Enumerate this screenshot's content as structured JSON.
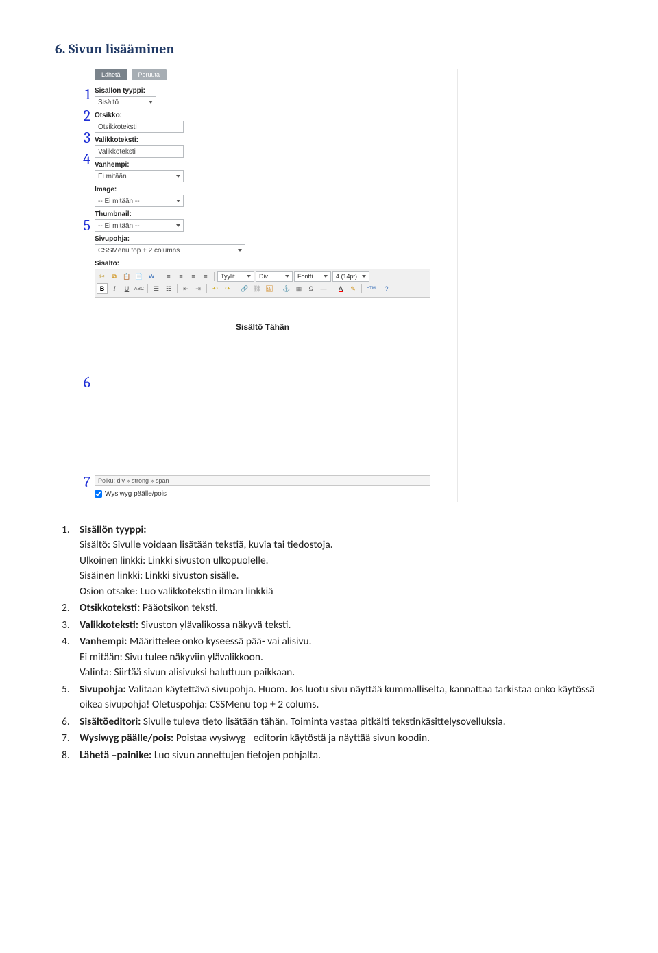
{
  "heading": "6.  Sivun lisääminen",
  "screenshot": {
    "numbers": [
      "1",
      "2",
      "3",
      "4",
      "5",
      "6",
      "7"
    ],
    "btn_submit": "Lähetä",
    "btn_cancel": "Peruuta",
    "labels": {
      "content_type": "Sisällön tyyppi:",
      "title": "Otsikko:",
      "menu_text": "Valikkoteksti:",
      "parent": "Vanhempi:",
      "image": "Image:",
      "thumbnail": "Thumbnail:",
      "template": "Sivupohja:",
      "content": "Sisältö:",
      "path": "Polku: div » strong » span",
      "wysiwyg": "Wysiwyg päälle/pois"
    },
    "values": {
      "content_type": "Sisältö",
      "title": "Otsikkoteksti",
      "menu_text": "Valikkoteksti",
      "parent": "Ei mitään",
      "image": "-- Ei mitään --",
      "thumbnail": "-- Ei mitään --",
      "template": "CSSMenu top + 2 columns"
    },
    "toolbar": {
      "sel_style": "Tyylit",
      "sel_block": "Div",
      "sel_font": "Fontti",
      "sel_size": "4 (14pt)",
      "b": "B",
      "i": "I",
      "u": "U",
      "abc": "ABC",
      "html_label": "HTML"
    },
    "editor_placeholder": "Sisältö Tähän"
  },
  "list": [
    {
      "lead": "Sisällön tyyppi:",
      "lines": [
        "Sisältö: Sivulle voidaan lisätään tekstiä, kuvia tai tiedostoja.",
        "Ulkoinen linkki: Linkki sivuston ulkopuolelle.",
        "Sisäinen linkki: Linkki sivuston sisälle.",
        "Osion otsake: Luo valikkotekstin ilman linkkiä"
      ]
    },
    {
      "lead": "Otsikkoteksti:",
      "lines": [
        "Pääotsikon teksti."
      ]
    },
    {
      "lead": "Valikkoteksti:",
      "lines": [
        "Sivuston ylävalikossa näkyvä teksti."
      ]
    },
    {
      "lead": "Vanhempi:",
      "lines": [
        "Määrittelee onko kyseessä pää- vai alisivu.",
        "Ei mitään: Sivu tulee näkyviin ylävalikkoon.",
        "Valinta: Siirtää sivun alisivuksi haluttuun paikkaan."
      ]
    },
    {
      "lead": "Sivupohja:",
      "lines": [
        "Valitaan käytettävä sivupohja. Huom. Jos luotu sivu näyttää kummalliselta, kannattaa tarkistaa onko käytössä oikea sivupohja! Oletuspohja: CSSMenu top + 2 colums."
      ]
    },
    {
      "lead": "Sisältöeditori:",
      "lines": [
        "Sivulle tuleva tieto lisätään tähän. Toiminta vastaa pitkälti tekstinkäsittelysovelluksia."
      ]
    },
    {
      "lead": "Wysiwyg päälle/pois:",
      "lines": [
        "Poistaa wysiwyg –editorin käytöstä ja näyttää sivun koodin."
      ]
    },
    {
      "lead": "Lähetä –painike:",
      "lines": [
        "Luo sivun annettujen tietojen pohjalta."
      ]
    }
  ]
}
